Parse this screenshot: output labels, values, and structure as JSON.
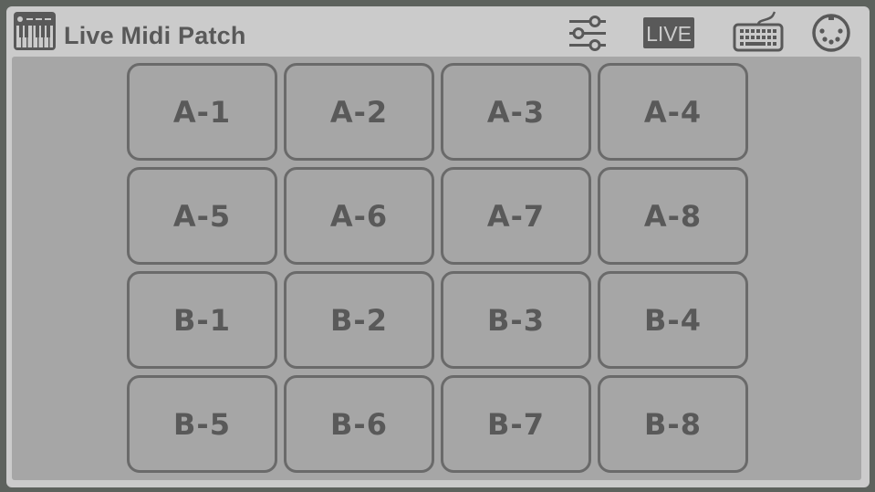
{
  "app": {
    "title": "Live Midi Patch",
    "icon": "midi-keyboard-icon"
  },
  "toolbar": {
    "buttons": [
      {
        "name": "mixer-settings-button",
        "icon": "sliders-icon"
      },
      {
        "name": "live-mode-button",
        "icon": "live-badge-icon",
        "label": "LIVE"
      },
      {
        "name": "keyboard-button",
        "icon": "keyboard-icon"
      },
      {
        "name": "midi-port-button",
        "icon": "midi-din-icon"
      }
    ]
  },
  "pads": [
    {
      "label": "A-1"
    },
    {
      "label": "A-2"
    },
    {
      "label": "A-3"
    },
    {
      "label": "A-4"
    },
    {
      "label": "A-5"
    },
    {
      "label": "A-6"
    },
    {
      "label": "A-7"
    },
    {
      "label": "A-8"
    },
    {
      "label": "B-1"
    },
    {
      "label": "B-2"
    },
    {
      "label": "B-3"
    },
    {
      "label": "B-4"
    },
    {
      "label": "B-5"
    },
    {
      "label": "B-6"
    },
    {
      "label": "B-7"
    },
    {
      "label": "B-8"
    }
  ],
  "colors": {
    "background": "#5d625d",
    "header": "#cbcbcb",
    "panel": "#a6a6a6",
    "pad_border": "#6a6a6a",
    "text": "#595959"
  }
}
